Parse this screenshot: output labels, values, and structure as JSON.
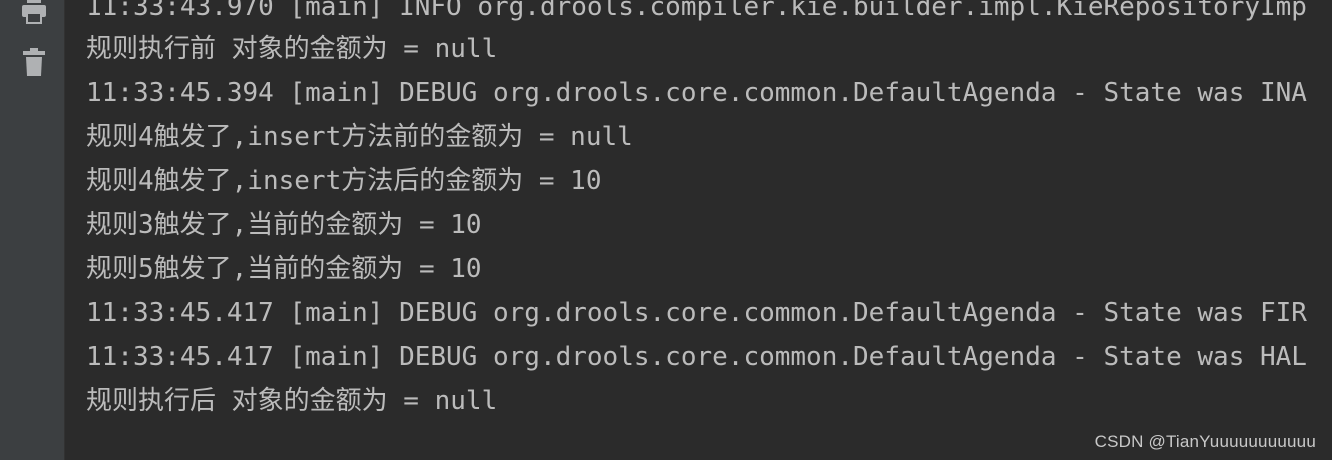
{
  "console": {
    "lines": [
      "11:33:43.970 [main] INFO org.drools.compiler.kie.builder.impl.KieRepositoryImp",
      "规则执行前 对象的金额为 = null",
      "11:33:45.394 [main] DEBUG org.drools.core.common.DefaultAgenda - State was INA",
      "规则4触发了,insert方法前的金额为 = null",
      "规则4触发了,insert方法后的金额为 = 10",
      "规则3触发了,当前的金额为 = 10",
      "规则5触发了,当前的金额为 = 10",
      "11:33:45.417 [main] DEBUG org.drools.core.common.DefaultAgenda - State was FIR",
      "11:33:45.417 [main] DEBUG org.drools.core.common.DefaultAgenda - State was HAL",
      "规则执行后 对象的金额为 = null"
    ]
  },
  "gutter": {
    "buttons": [
      {
        "icon": "print-icon"
      },
      {
        "icon": "trash-icon"
      }
    ]
  },
  "watermark": "CSDN @TianYuuuuuuuuuuu",
  "colors": {
    "background": "#2b2b2b",
    "gutter": "#3c3f41",
    "text": "#bbbbbb",
    "icon": "#afb1b3"
  }
}
